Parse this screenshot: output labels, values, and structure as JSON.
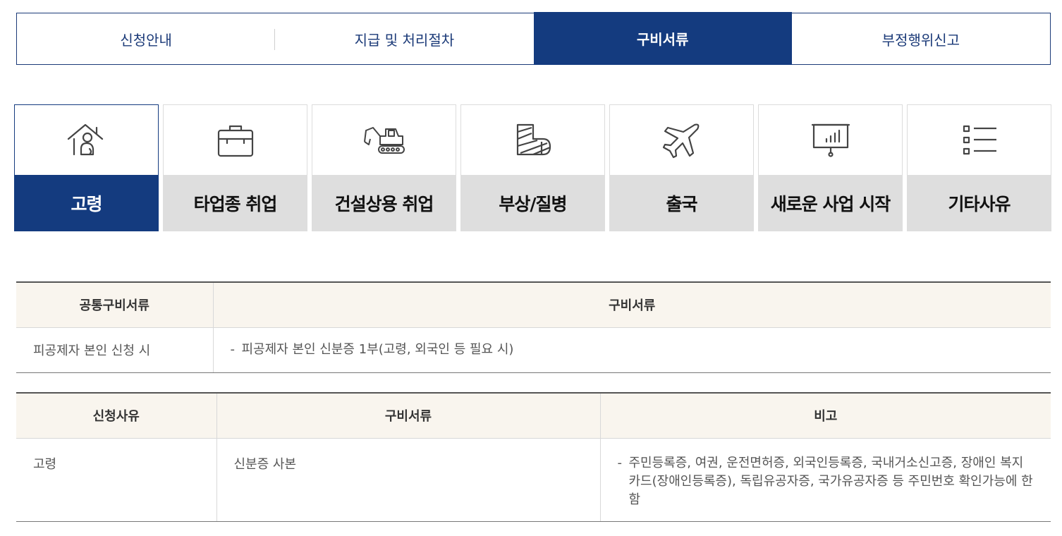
{
  "top_tabs": [
    {
      "label": "신청안내",
      "active": false
    },
    {
      "label": "지급 및 처리절차",
      "active": false
    },
    {
      "label": "구비서류",
      "active": true
    },
    {
      "label": "부정행위신고",
      "active": false
    }
  ],
  "categories": [
    {
      "label": "고령",
      "icon": "elderly-house-icon",
      "active": true
    },
    {
      "label": "타업종 취업",
      "icon": "briefcase-icon",
      "active": false
    },
    {
      "label": "건설상용 취업",
      "icon": "excavator-icon",
      "active": false
    },
    {
      "label": "부상/질병",
      "icon": "cast-leg-icon",
      "active": false
    },
    {
      "label": "출국",
      "icon": "airplane-icon",
      "active": false
    },
    {
      "label": "새로운 사업 시작",
      "icon": "presentation-board-icon",
      "active": false
    },
    {
      "label": "기타사유",
      "icon": "list-icon",
      "active": false
    }
  ],
  "common_table": {
    "headers": [
      "공통구비서류",
      "구비서류"
    ],
    "rows": [
      {
        "case": "피공제자 본인 신청 시",
        "doc": "피공제자 본인 신분증 1부(고령, 외국인 등 필요 시)"
      }
    ]
  },
  "reason_table": {
    "headers": [
      "신청사유",
      "구비서류",
      "비고"
    ],
    "rows": [
      {
        "reason": "고령",
        "doc": "신분증 사본",
        "note": "주민등록증, 여권, 운전면허증, 외국인등록증, 국내거소신고증, 장애인 복지카드(장애인등록증), 독립유공자증, 국가유공자증 등 주민번호 확인가능에 한함"
      }
    ]
  },
  "colors": {
    "primary": "#143b7f",
    "header_bg": "#f9f5ee",
    "inactive_label_bg": "#dedede"
  }
}
